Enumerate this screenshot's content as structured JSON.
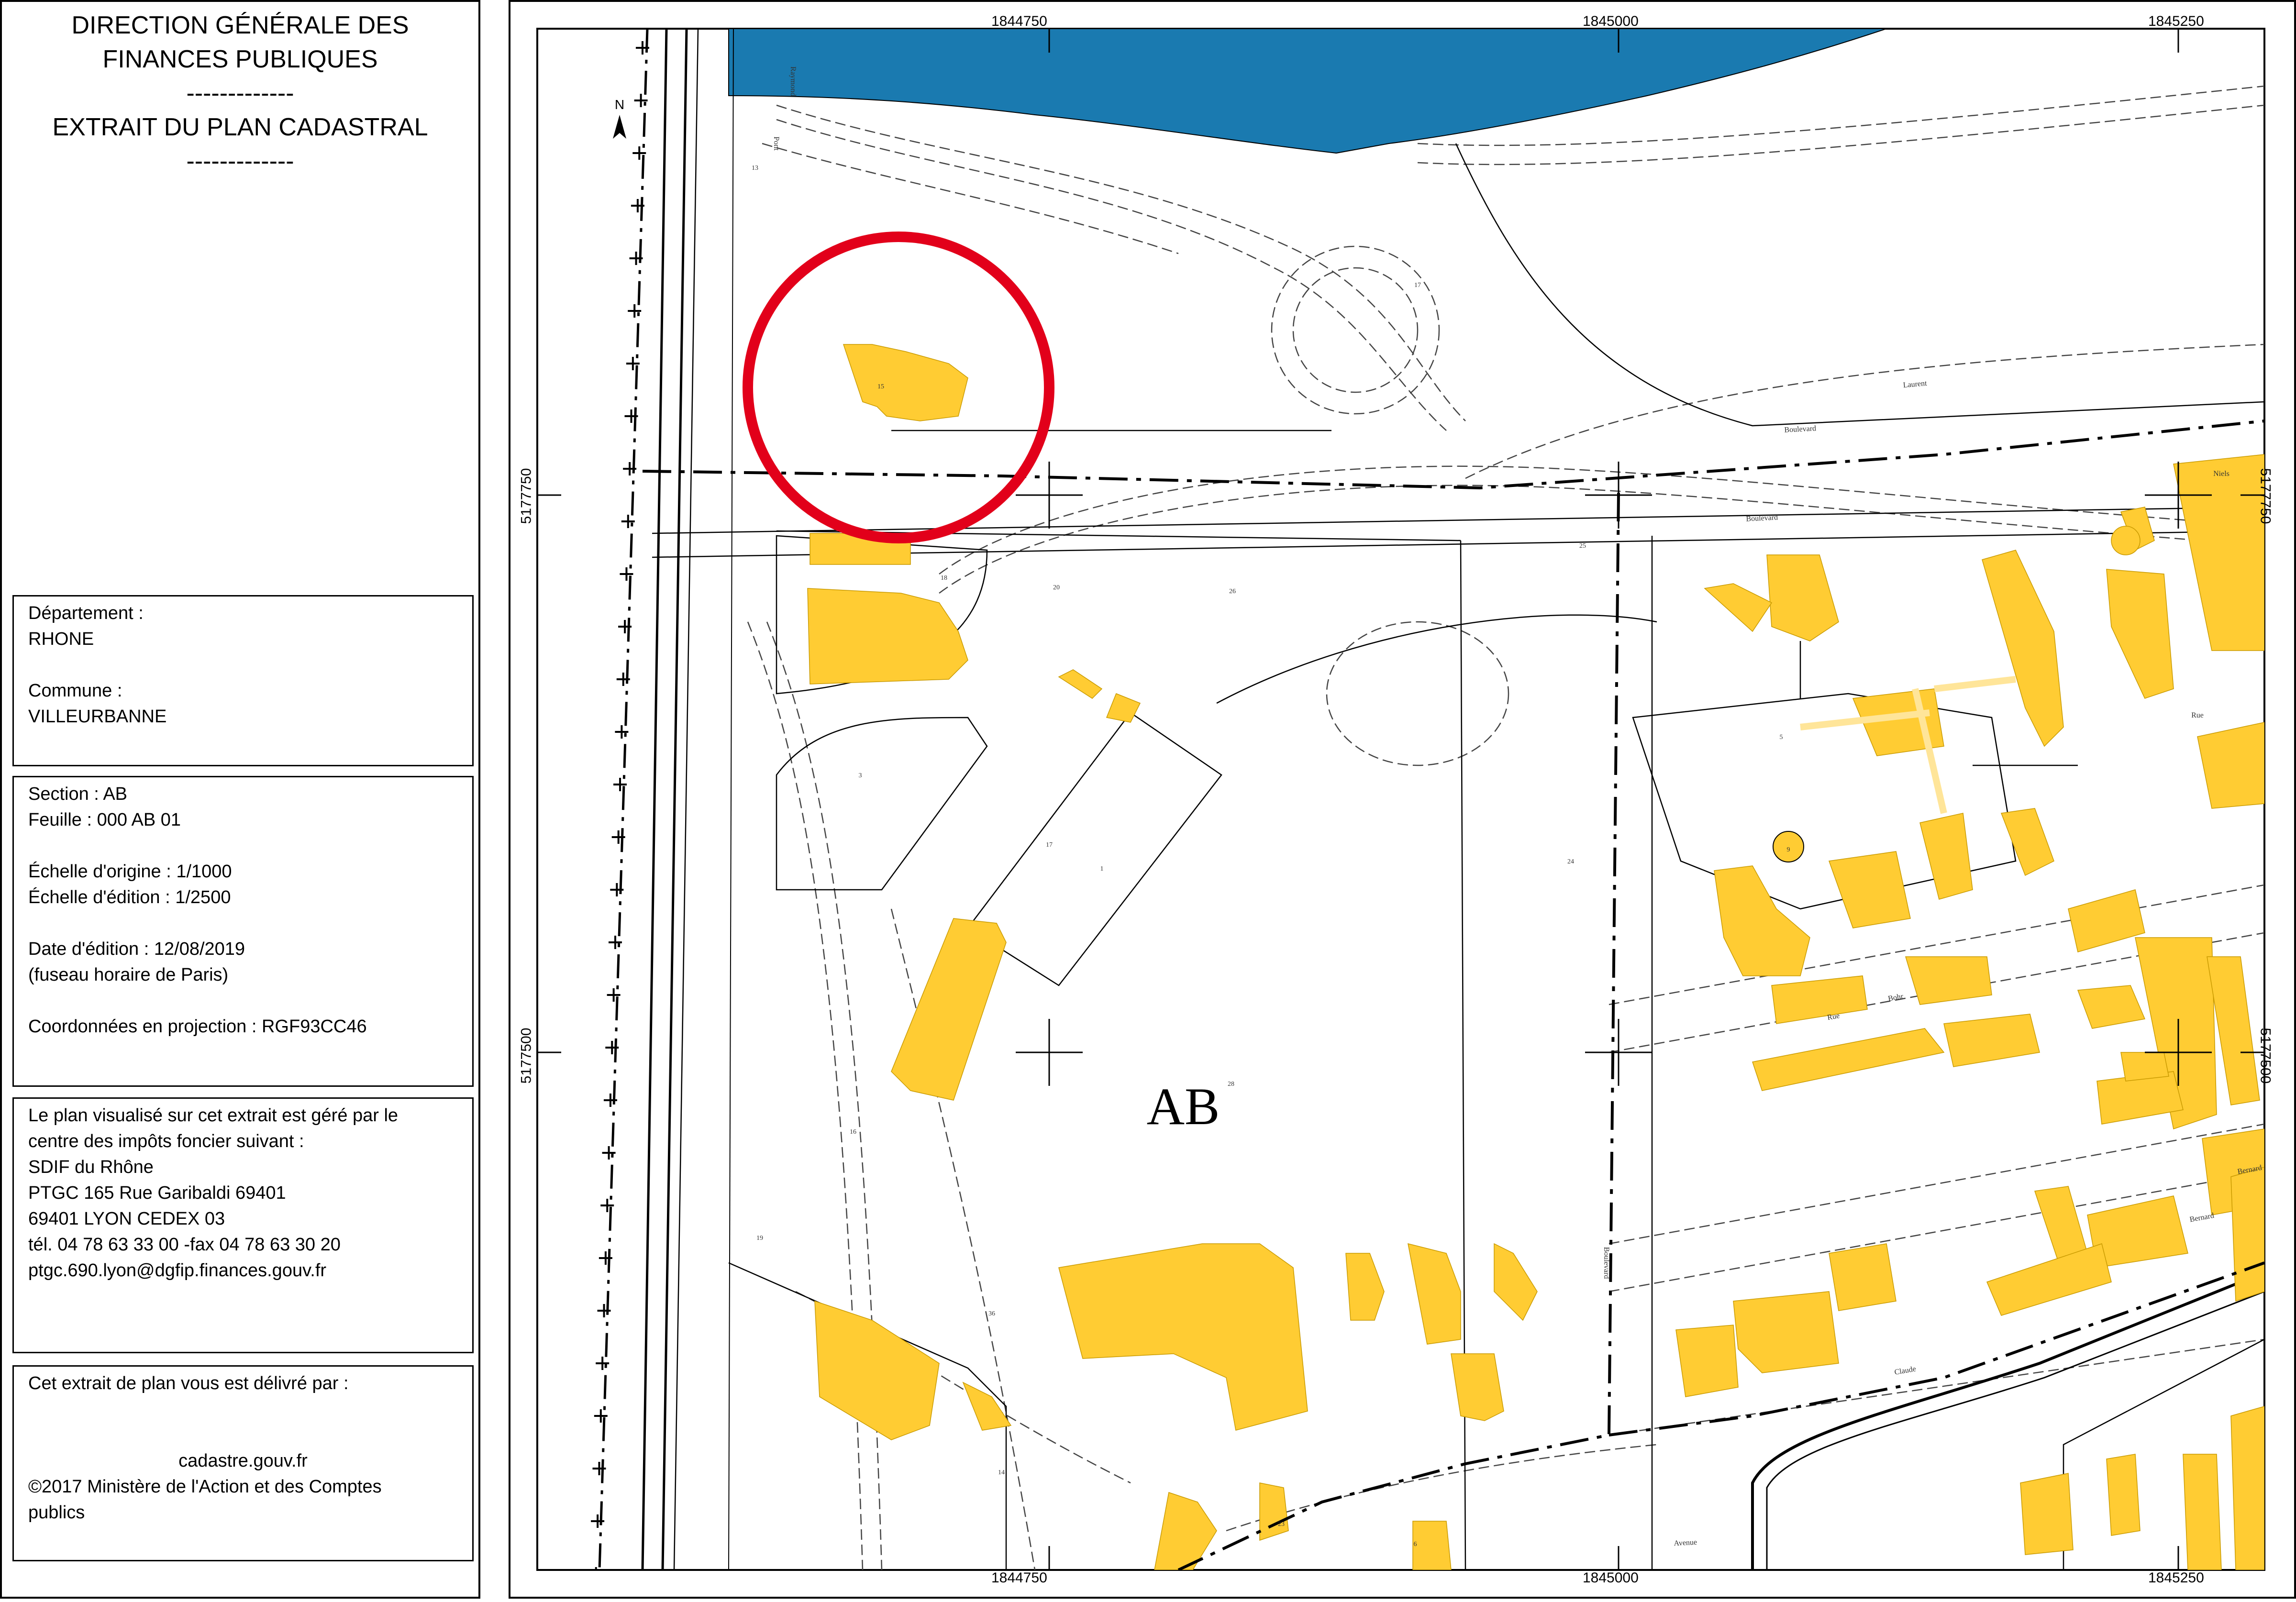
{
  "header": {
    "line1": "DIRECTION GÉNÉRALE DES",
    "line2": "FINANCES PUBLIQUES",
    "sep1": "-------------",
    "line3": "EXTRAIT DU PLAN CADASTRAL",
    "sep2": "-------------"
  },
  "departement": {
    "label": "Département :",
    "value": "RHONE",
    "commune_label": "Commune :",
    "commune_value": "VILLEURBANNE"
  },
  "section": {
    "section": "Section : AB",
    "feuille": "Feuille : 000 AB 01",
    "echelle_origine": "Échelle d'origine : 1/1000",
    "echelle_edition": "Échelle d'édition : 1/2500",
    "date_edition": "Date d'édition : 12/08/2019",
    "fuseau": "(fuseau horaire de Paris)",
    "coordonnees": "Coordonnées en projection : RGF93CC46"
  },
  "centre": {
    "l1": "Le plan visualisé sur cet extrait est géré par le",
    "l2": "centre des impôts foncier suivant :",
    "l3": "SDIF du Rhône",
    "l4": "PTGC 165 Rue Garibaldi 69401",
    "l5": "69401 LYON CEDEX 03",
    "l6": "tél. 04 78 63 33 00 -fax 04 78 63 30 20",
    "l7": "ptgc.690.lyon@dgfip.finances.gouv.fr"
  },
  "delivered": {
    "l1": "Cet extrait de plan vous est délivré par :",
    "l2": "cadastre.gouv.fr",
    "l3": "©2017 Ministère de l'Action et des Comptes",
    "l4": "publics"
  },
  "map": {
    "section_label": "AB",
    "north_label": "N",
    "coords_top": [
      "1844750",
      "1845000",
      "1845250"
    ],
    "coords_bottom": [
      "1844750",
      "1845000",
      "1845250"
    ],
    "coords_left": [
      "5177750",
      "5177500"
    ],
    "coords_right": [
      "5177750",
      "5177500"
    ],
    "parcel_numbers": [
      "15",
      "17",
      "18",
      "20",
      "26",
      "25",
      "3",
      "5",
      "9",
      "17",
      "1",
      "24",
      "28",
      "16",
      "14",
      "23",
      "19",
      "13",
      "6",
      "36"
    ],
    "street_labels": [
      "Laurent",
      "Boulevard",
      "Niels",
      "Boulevard",
      "Rue",
      "Bernard",
      "Rue",
      "Bohr",
      "Claude",
      "Bernard",
      "Boulevard",
      "Pont",
      "Raymond",
      "Avenue"
    ],
    "colors": {
      "building": "#ffcc33",
      "building_light": "#ffe599",
      "water": "#1a7ab0",
      "highlight_circle": "#e2001a",
      "line": "#000000"
    }
  }
}
